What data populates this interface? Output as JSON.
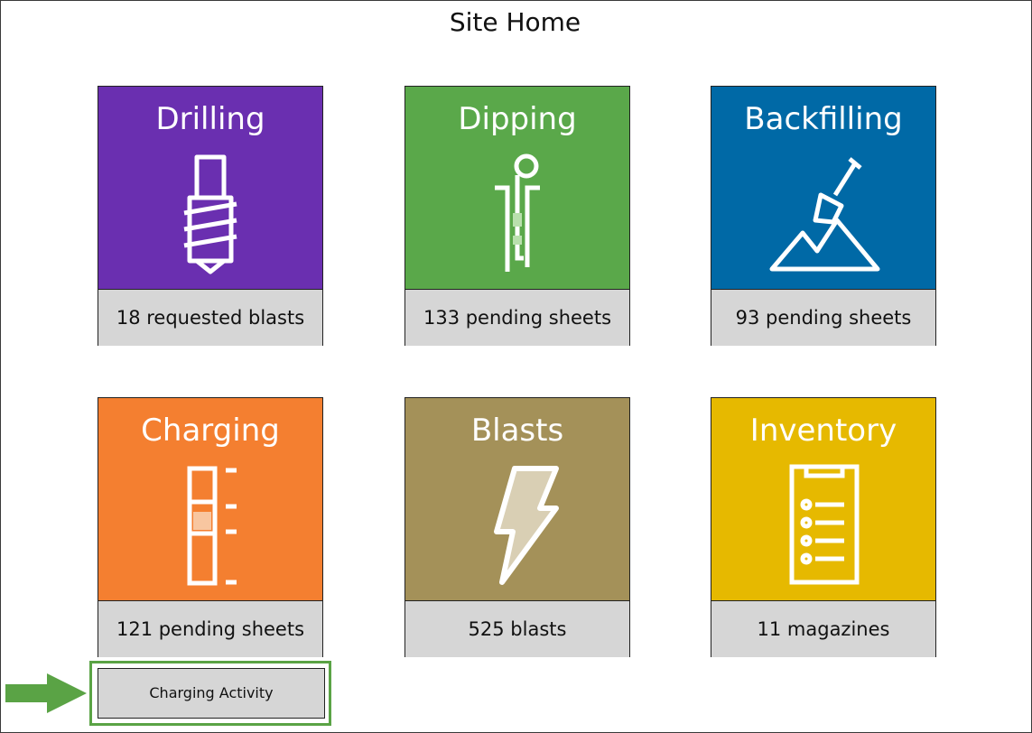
{
  "page": {
    "title": "Site Home"
  },
  "tiles": [
    {
      "id": "drilling",
      "label": "Drilling",
      "footer": "18 requested blasts",
      "color": "#6a2fb0",
      "icon": "drill-bit-icon"
    },
    {
      "id": "dipping",
      "label": "Dipping",
      "footer": "133 pending sheets",
      "color": "#5aa84a",
      "icon": "dip-tape-icon"
    },
    {
      "id": "backfilling",
      "label": "Backfilling",
      "footer": "93 pending sheets",
      "color": "#0069a6",
      "icon": "shovel-mountain-icon"
    },
    {
      "id": "charging",
      "label": "Charging",
      "footer": "121 pending sheets",
      "color": "#f47f30",
      "icon": "charge-column-icon"
    },
    {
      "id": "blasts",
      "label": "Blasts",
      "footer": "525 blasts",
      "color": "#a49159",
      "icon": "lightning-icon"
    },
    {
      "id": "inventory",
      "label": "Inventory",
      "footer": "11 magazines",
      "color": "#e6b900",
      "icon": "clipboard-list-icon"
    }
  ],
  "action": {
    "label": "Charging Activity"
  },
  "colors": {
    "highlight": "#5aa345",
    "footer_bg": "#d6d6d6"
  }
}
